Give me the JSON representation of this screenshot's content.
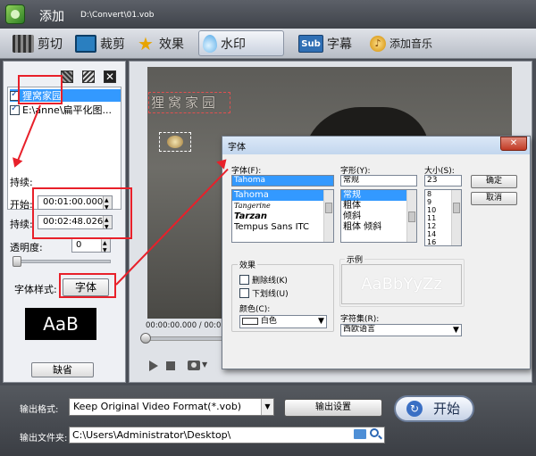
{
  "titlebar": {
    "add_label": "添加",
    "file_path": "D:\\Convert\\01.vob"
  },
  "toolbar": {
    "items": [
      {
        "label": "剪切",
        "icon": "film-cut-icon"
      },
      {
        "label": "裁剪",
        "icon": "crop-icon"
      },
      {
        "label": "效果",
        "icon": "star-effect-icon"
      },
      {
        "label": "水印",
        "icon": "water-drop-icon",
        "active": true
      },
      {
        "label": "字幕",
        "icon": "subtitle-icon"
      },
      {
        "label": "添加音乐",
        "icon": "music-icon"
      }
    ],
    "effect_glyph": "★",
    "subtitle_glyph": "Sub",
    "music_glyph": "♪"
  },
  "left_panel": {
    "close_glyph": "✕",
    "watermarks": [
      {
        "label": "狸窝家园",
        "checked": true,
        "selected": true
      },
      {
        "label": "E:\\anne\\扁平化图...",
        "checked": true,
        "selected": false
      }
    ],
    "duration_label": "持续:",
    "start_label": "开始:",
    "start_value": "00:01:00.000",
    "length_label": "持续:",
    "length_value": "00:02:48.026",
    "opacity_label": "透明度:",
    "opacity_value": "0",
    "font_style_label": "字体样式:",
    "font_button": "字体",
    "font_preview": "AaB",
    "default_button": "缺省"
  },
  "player": {
    "watermark_text": "狸窝家园",
    "time_display": "00:00:00.000 / 00:03",
    "camera_dropdown": "▼"
  },
  "bottom": {
    "output_format_label": "输出格式:",
    "output_format_value": "Keep Original Video Format(*.vob)",
    "output_settings_button": "输出设置",
    "start_button": "开始",
    "start_glyph": "↻",
    "output_folder_label": "输出文件夹:",
    "output_folder_value": "C:\\Users\\Administrator\\Desktop\\"
  },
  "font_dialog": {
    "title": "字体",
    "close_glyph": "✕",
    "font_label": "字体(F):",
    "font_value": "Tahoma",
    "font_list": [
      "Tahoma",
      "Tangerine",
      "Tarzan",
      "Tempus Sans ITC"
    ],
    "style_label": "字形(Y):",
    "style_value": "常规",
    "style_list": [
      "常规",
      "粗体",
      "倾斜",
      "粗体 倾斜"
    ],
    "size_label": "大小(S):",
    "size_value": "23",
    "size_list": [
      "8",
      "9",
      "10",
      "11",
      "12",
      "14",
      "16"
    ],
    "ok_button": "确定",
    "cancel_button": "取消",
    "effects_label": "效果",
    "strikeout_label": "删除线(K)",
    "underline_label": "下划线(U)",
    "color_label": "颜色(C):",
    "color_value": "白色",
    "sample_label": "示例",
    "sample_text": "AaBbYyZz",
    "charset_label": "字符集(R):",
    "charset_value": "西欧语言",
    "dropdown_glyph": "▼"
  },
  "colors": {
    "annotation_red": "#e8202a",
    "selection_blue": "#3399ff"
  }
}
